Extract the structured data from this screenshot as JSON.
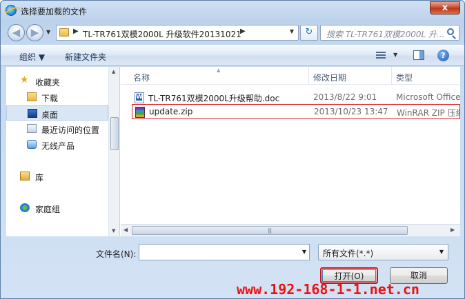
{
  "window": {
    "title": "选择要加载的文件",
    "close_label": "x"
  },
  "navbar": {
    "back_glyph": "◀",
    "forward_glyph": "▶",
    "address_path": "TL-TR761双模2000L 升级软件20131021",
    "refresh_glyph": "↻",
    "search_placeholder": "搜索 TL-TR761双模2000L 升..."
  },
  "toolbar": {
    "organize_label": "组织 ▼",
    "new_folder_label": "新建文件夹",
    "help_label": "?"
  },
  "sidebar": {
    "favorites_label": "收藏夹",
    "items": [
      {
        "label": "下载",
        "icon": "download-folder-icon"
      },
      {
        "label": "桌面",
        "icon": "desktop-icon",
        "selected": true
      },
      {
        "label": "最近访问的位置",
        "icon": "recent-places-icon"
      },
      {
        "label": "无线产品",
        "icon": "wireless-products-icon"
      }
    ],
    "libraries_label": "库",
    "homegroup_label": "家庭组"
  },
  "file_list": {
    "columns": {
      "name": "名称",
      "date": "修改日期",
      "type": "类型"
    },
    "rows": [
      {
        "name": "TL-TR761双模2000L升级帮助.doc",
        "date": "2013/8/22 9:01",
        "type": "Microsoft Office",
        "icon": "word-doc-icon",
        "highlighted": false
      },
      {
        "name": "update.zip",
        "date": "2013/10/23 13:47",
        "type": "WinRAR ZIP 压缩",
        "icon": "winrar-zip-icon",
        "highlighted": true
      }
    ]
  },
  "footer": {
    "filename_label": "文件名(N):",
    "filename_value": "",
    "filetype_value": "所有文件(*.*)",
    "open_label": "打开(O)",
    "cancel_label": "取消"
  },
  "watermark": {
    "text": "www.192-168-1-1.net.cn"
  },
  "colors": {
    "highlight_border": "#d8181d",
    "watermark": "#f01010",
    "selected_nav": "#d9e6f4"
  }
}
